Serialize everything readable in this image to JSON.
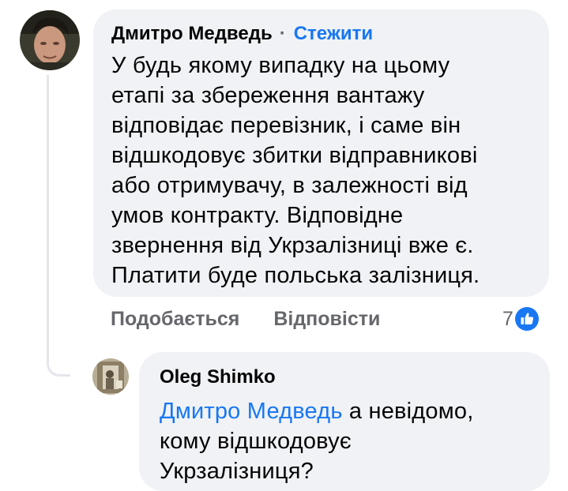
{
  "comment": {
    "author": "Дмитро Медведь",
    "separator": "·",
    "follow_label": "Стежити",
    "text_lines": [
      "У будь якому випадку на цьому",
      "етапі за збереження вантажу",
      "відповідає перевізник, і саме він",
      "відшкодовує збитки відправникові",
      "або отримувачу, в залежності від",
      "умов контракту. Відповідне",
      "звернення від Укрзалізниці вже є.",
      "Платити буде польська залізниця."
    ],
    "like_label": "Подобається",
    "reply_label": "Відповісти",
    "reaction_count": "7",
    "reaction_icon": "like-thumbs-up-icon",
    "accent_color": "#1877f2"
  },
  "reply": {
    "author": "Oleg Shimko",
    "mention": "Дмитро Медведь",
    "text_first": " а невідомо,",
    "text_lines": [
      "кому відшкодовує",
      "Укрзалізниця?"
    ]
  }
}
